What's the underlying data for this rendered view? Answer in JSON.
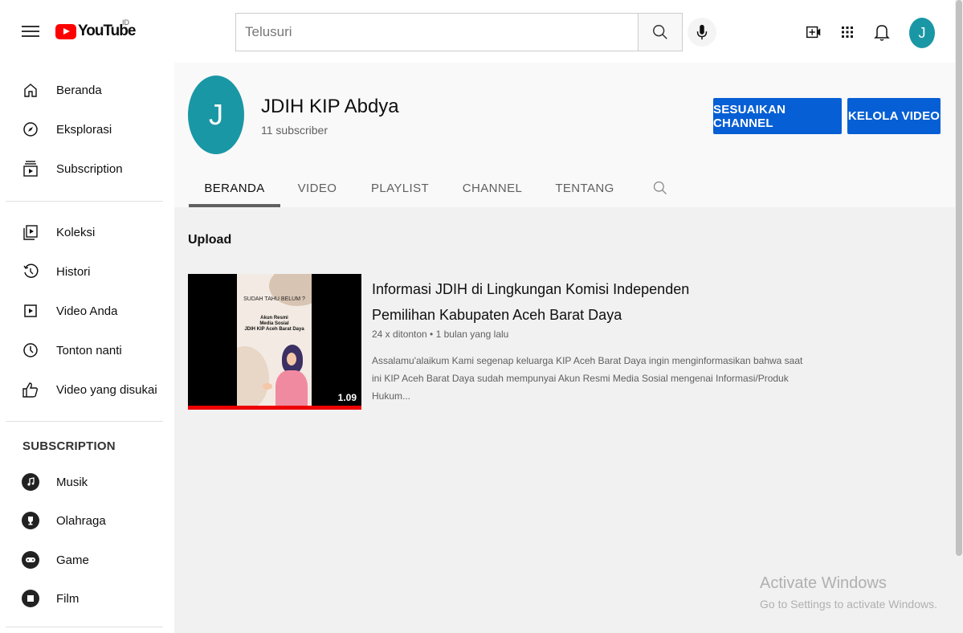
{
  "header": {
    "logo_text": "YouTube",
    "logo_region": "ID",
    "search_placeholder": "Telusuri",
    "avatar_initial": "J"
  },
  "sidebar": {
    "main_items": [
      {
        "label": "Beranda",
        "icon": "home-icon"
      },
      {
        "label": "Eksplorasi",
        "icon": "compass-icon"
      },
      {
        "label": "Subscription",
        "icon": "subscriptions-icon"
      }
    ],
    "library_items": [
      {
        "label": "Koleksi",
        "icon": "library-icon"
      },
      {
        "label": "Histori",
        "icon": "history-icon"
      },
      {
        "label": "Video Anda",
        "icon": "your-videos-icon"
      },
      {
        "label": "Tonton nanti",
        "icon": "watch-later-icon"
      },
      {
        "label": "Video yang disukai",
        "icon": "thumbs-up-icon"
      }
    ],
    "subscription_heading": "SUBSCRIPTION",
    "subscriptions": [
      {
        "label": "Musik",
        "icon": "music-icon"
      },
      {
        "label": "Olahraga",
        "icon": "trophy-icon"
      },
      {
        "label": "Game",
        "icon": "gamepad-icon"
      },
      {
        "label": "Film",
        "icon": "film-icon"
      }
    ]
  },
  "channel": {
    "avatar_initial": "J",
    "name": "JDIH KIP Abdya",
    "subscribers": "11 subscriber",
    "customize_button": "SESUAIKAN CHANNEL",
    "manage_button": "KELOLA VIDEO",
    "tabs": [
      "BERANDA",
      "VIDEO",
      "PLAYLIST",
      "CHANNEL",
      "TENTANG"
    ],
    "active_tab": "BERANDA"
  },
  "uploads": {
    "section_title": "Upload",
    "videos": [
      {
        "title": "Informasi JDIH di Lingkungan Komisi Independen Pemilihan Kabupaten Aceh Barat Daya",
        "meta": "24 x ditonton • 1 bulan yang lalu",
        "description": "Assalamu'alaikum Kami segenap keluarga KIP Aceh Barat Daya ingin menginformasikan bahwa saat ini KIP Aceh Barat Daya sudah mempunyai Akun Resmi Media Sosial mengenai Informasi/Produk Hukum...",
        "duration": "1.09",
        "thumb_line1": "SUDAH TAHU BELUM ?",
        "thumb_line2": "Akun Resmi",
        "thumb_line3": "Media Sosial",
        "thumb_line4": "JDIH KIP Aceh Barat Daya",
        "watched_fraction": 1.0
      }
    ]
  },
  "watermark": {
    "line1": "Activate Windows",
    "line2": "Go to Settings to activate Windows."
  },
  "colors": {
    "accent_blue": "#065fd4",
    "avatar": "#1a97a5",
    "brand_red": "#ff0000"
  }
}
